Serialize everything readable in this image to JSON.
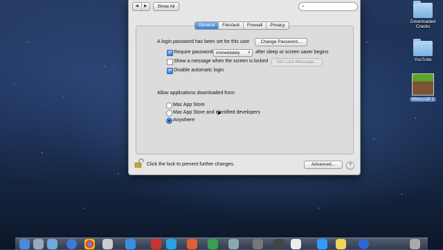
{
  "toolbar": {
    "show_all_label": "Show All",
    "search_placeholder": ""
  },
  "tabs": [
    {
      "label": "General",
      "active": true
    },
    {
      "label": "FileVault",
      "active": false
    },
    {
      "label": "Firewall",
      "active": false
    },
    {
      "label": "Privacy",
      "active": false
    }
  ],
  "general": {
    "login_password_text": "A login password has been set for this user",
    "change_password_button": "Change Password...",
    "require_password": {
      "label": "Require password",
      "checked": true
    },
    "require_password_select": "immediately",
    "after_sleep_text": "after sleep or screen saver begins",
    "show_message": {
      "label": "Show a message when the screen is locked",
      "checked": false
    },
    "set_lock_message_button": "Set Lock Message...",
    "disable_auto_login": {
      "label": "Disable automatic login",
      "checked": true
    },
    "allow_apps_heading": "Allow applications downloaded from:",
    "radio_options": [
      {
        "label": "Mac App Store",
        "selected": false
      },
      {
        "label": "Mac App Store and identified developers",
        "selected": false
      },
      {
        "label": "Anywhere",
        "selected": true
      }
    ]
  },
  "footer": {
    "lock_text": "Click the lock to prevent further changes.",
    "advanced_button": "Advanced...",
    "help_label": "?"
  },
  "desktop": {
    "icons": [
      {
        "label": "Downloaded Cracks"
      },
      {
        "label": "YouTube"
      },
      {
        "label": "Minecraft 2"
      }
    ]
  },
  "colors": {
    "accent": "#3d7fd4",
    "window_bg": "#e6e6e6"
  }
}
